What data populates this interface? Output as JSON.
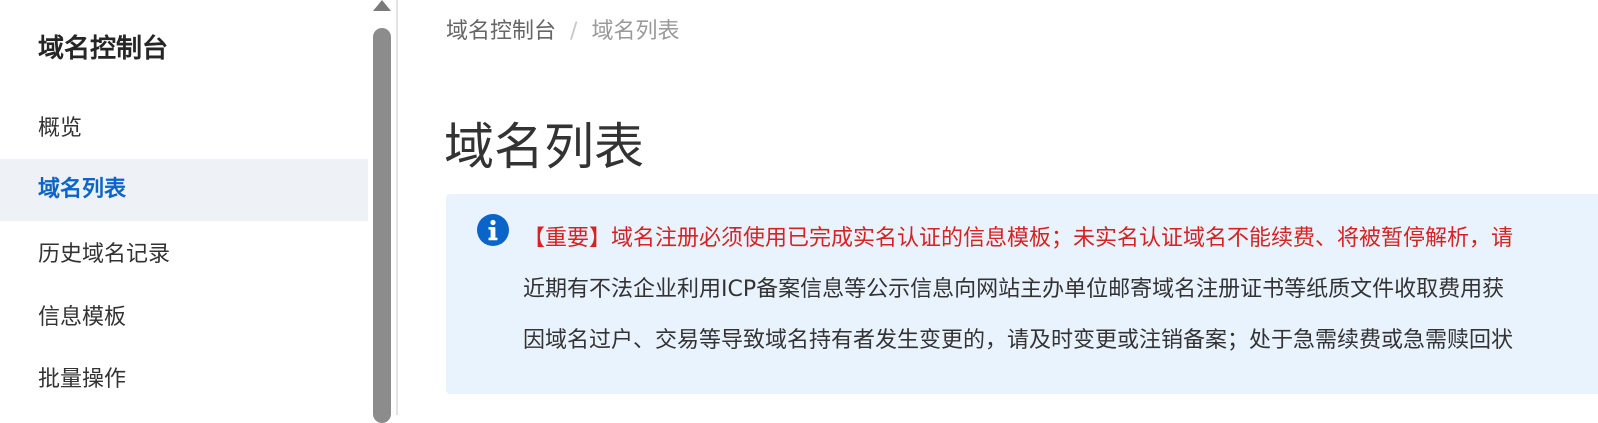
{
  "sidebar": {
    "title": "域名控制台",
    "items": [
      {
        "label": "概览",
        "active": false
      },
      {
        "label": "域名列表",
        "active": true
      },
      {
        "label": "历史域名记录",
        "active": false
      },
      {
        "label": "信息模板",
        "active": false
      },
      {
        "label": "批量操作",
        "active": false
      }
    ]
  },
  "breadcrumb": {
    "root": "域名控制台",
    "separator": "/",
    "current": "域名列表"
  },
  "page": {
    "title": "域名列表"
  },
  "notice": {
    "icon": "info-icon",
    "lines": [
      "【重要】域名注册必须使用已完成实名认证的信息模板；未实名认证域名不能续费、将被暂停解析，请",
      "近期有不法企业利用ICP备案信息等公示信息向网站主办单位邮寄域名注册证书等纸质文件收取费用获",
      "因域名过户、交易等导致域名持有者发生变更的，请及时变更或注销备案；处于急需续费或急需赎回状"
    ]
  },
  "colors": {
    "accent": "#0b65c8",
    "active_bg": "#eef1f5",
    "notice_bg": "#e9f3fe",
    "important_text": "#d62222"
  }
}
